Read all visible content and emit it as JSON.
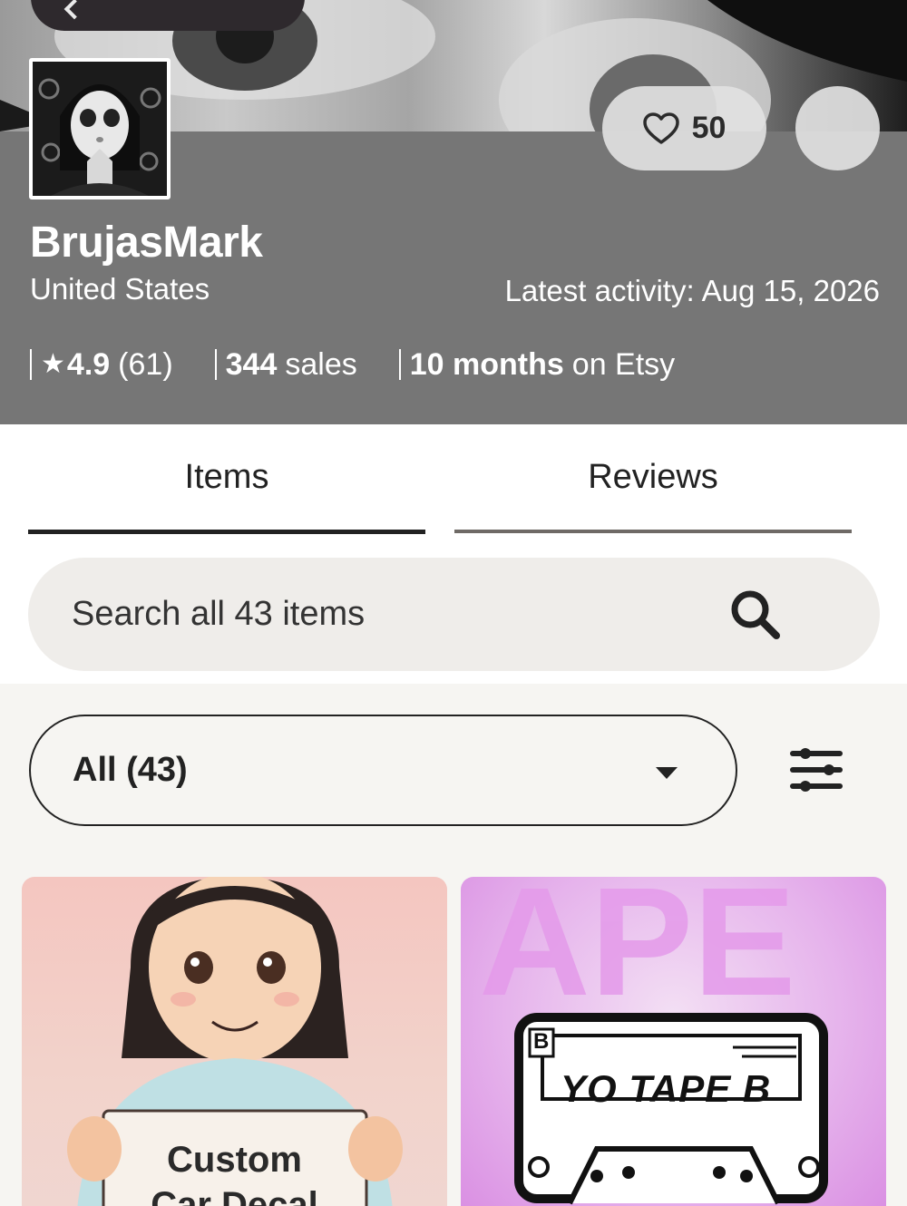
{
  "header": {
    "favorites_count": "50",
    "shop_name": "BrujasMark",
    "location": "United States",
    "latest_activity_label": "Latest activity:",
    "latest_activity_date": "Aug 15, 2026",
    "stats": {
      "rating": "4.9",
      "rating_count": "(61)",
      "sales_number": "344",
      "sales_word": "sales",
      "tenure_bold": "10 months",
      "tenure_rest": "on Etsy"
    }
  },
  "tabs": [
    {
      "label": "Items"
    },
    {
      "label": "Reviews"
    }
  ],
  "search": {
    "placeholder": "Search all 43 items"
  },
  "filter": {
    "selected": "All (43)"
  },
  "listings": [
    {
      "title_line1": "Custom",
      "title_line2": "Car Decal"
    },
    {
      "title": "YO TAPE B",
      "corner": "B"
    }
  ],
  "colors": {
    "header_bg": "#767676",
    "tab_active": "#222222",
    "search_bg": "#efedea"
  }
}
